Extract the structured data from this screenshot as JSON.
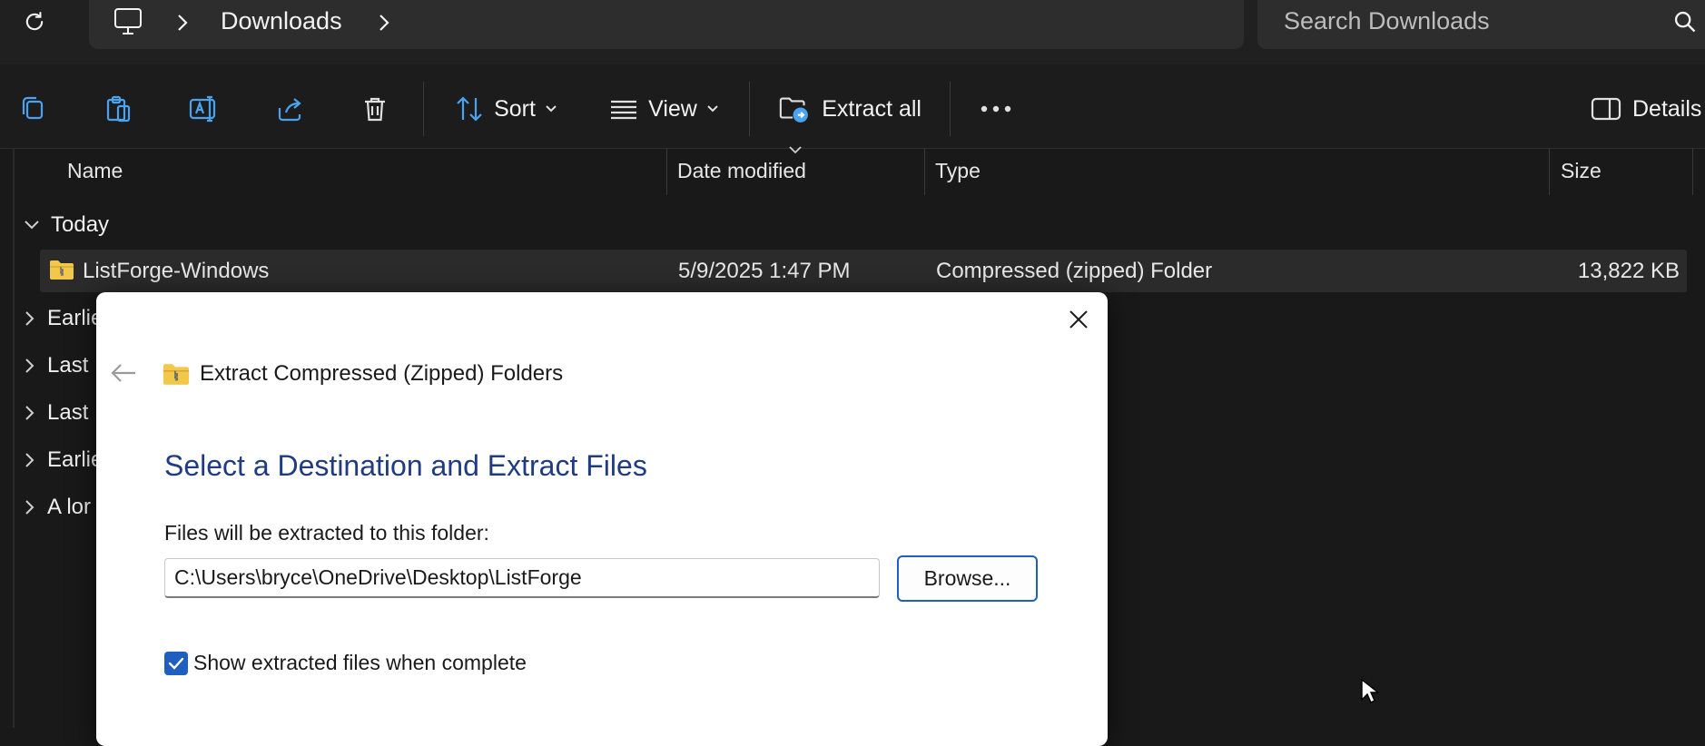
{
  "address_bar": {
    "breadcrumb": "Downloads",
    "search_placeholder": "Search Downloads"
  },
  "toolbar": {
    "sort_label": "Sort",
    "view_label": "View",
    "extract_all_label": "Extract all",
    "details_label": "Details"
  },
  "columns": {
    "name": "Name",
    "date_modified": "Date modified",
    "type": "Type",
    "size": "Size"
  },
  "groups": {
    "today": "Today",
    "earlier_this_week": "Earlie",
    "last_week": "Last ",
    "last_month": "Last ",
    "earlier_this_year": "Earlie",
    "a_long_time_ago": "A lor"
  },
  "file": {
    "name": "ListForge-Windows",
    "date_modified": "5/9/2025 1:47 PM",
    "type": "Compressed (zipped) Folder",
    "size": "13,822 KB"
  },
  "dialog": {
    "window_title": "Extract Compressed (Zipped) Folders",
    "heading": "Select a Destination and Extract Files",
    "instruction": "Files will be extracted to this folder:",
    "destination_path": "C:\\Users\\bryce\\OneDrive\\Desktop\\ListForge",
    "browse_label": "Browse...",
    "show_files_label": "Show extracted files when complete",
    "show_files_checked": true
  },
  "colors": {
    "accent_blue": "#1f5fbf",
    "heading_blue": "#1f3b82",
    "window_bg": "#191919",
    "selected_row_bg": "#2b2b2b",
    "zip_folder_yellow": "#f2c84b"
  },
  "icons": [
    "refresh-icon",
    "monitor-icon",
    "chevron-right-icon",
    "search-icon",
    "copy-icon",
    "paste-icon",
    "rename-icon",
    "share-icon",
    "delete-icon",
    "sort-icon",
    "view-icon",
    "extract-all-icon",
    "more-icon",
    "details-pane-icon",
    "zip-folder-icon",
    "close-icon",
    "back-arrow-icon",
    "checkmark-icon"
  ]
}
